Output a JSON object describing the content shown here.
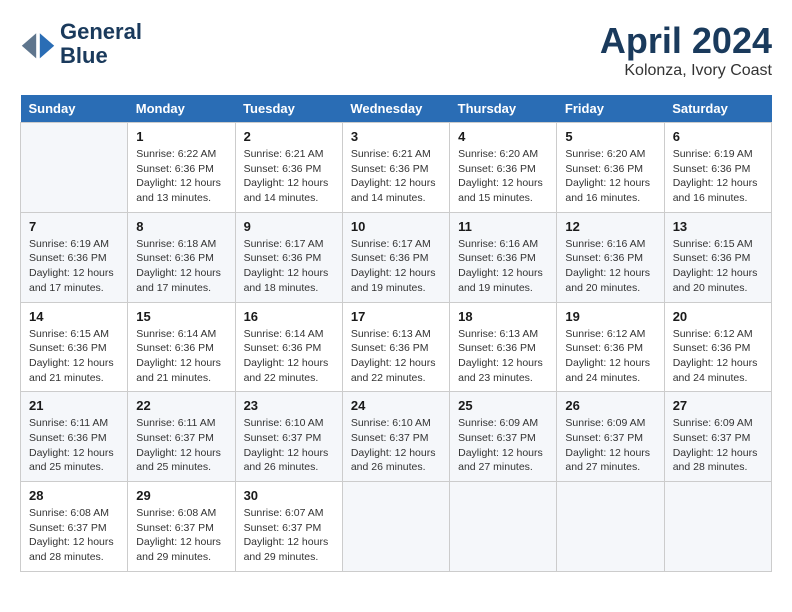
{
  "header": {
    "logo_line1": "General",
    "logo_line2": "Blue",
    "title": "April 2024",
    "subtitle": "Kolonza, Ivory Coast"
  },
  "calendar": {
    "days_of_week": [
      "Sunday",
      "Monday",
      "Tuesday",
      "Wednesday",
      "Thursday",
      "Friday",
      "Saturday"
    ],
    "weeks": [
      [
        {
          "day": "",
          "info": ""
        },
        {
          "day": "1",
          "info": "Sunrise: 6:22 AM\nSunset: 6:36 PM\nDaylight: 12 hours\nand 13 minutes."
        },
        {
          "day": "2",
          "info": "Sunrise: 6:21 AM\nSunset: 6:36 PM\nDaylight: 12 hours\nand 14 minutes."
        },
        {
          "day": "3",
          "info": "Sunrise: 6:21 AM\nSunset: 6:36 PM\nDaylight: 12 hours\nand 14 minutes."
        },
        {
          "day": "4",
          "info": "Sunrise: 6:20 AM\nSunset: 6:36 PM\nDaylight: 12 hours\nand 15 minutes."
        },
        {
          "day": "5",
          "info": "Sunrise: 6:20 AM\nSunset: 6:36 PM\nDaylight: 12 hours\nand 16 minutes."
        },
        {
          "day": "6",
          "info": "Sunrise: 6:19 AM\nSunset: 6:36 PM\nDaylight: 12 hours\nand 16 minutes."
        }
      ],
      [
        {
          "day": "7",
          "info": "Sunrise: 6:19 AM\nSunset: 6:36 PM\nDaylight: 12 hours\nand 17 minutes."
        },
        {
          "day": "8",
          "info": "Sunrise: 6:18 AM\nSunset: 6:36 PM\nDaylight: 12 hours\nand 17 minutes."
        },
        {
          "day": "9",
          "info": "Sunrise: 6:17 AM\nSunset: 6:36 PM\nDaylight: 12 hours\nand 18 minutes."
        },
        {
          "day": "10",
          "info": "Sunrise: 6:17 AM\nSunset: 6:36 PM\nDaylight: 12 hours\nand 19 minutes."
        },
        {
          "day": "11",
          "info": "Sunrise: 6:16 AM\nSunset: 6:36 PM\nDaylight: 12 hours\nand 19 minutes."
        },
        {
          "day": "12",
          "info": "Sunrise: 6:16 AM\nSunset: 6:36 PM\nDaylight: 12 hours\nand 20 minutes."
        },
        {
          "day": "13",
          "info": "Sunrise: 6:15 AM\nSunset: 6:36 PM\nDaylight: 12 hours\nand 20 minutes."
        }
      ],
      [
        {
          "day": "14",
          "info": "Sunrise: 6:15 AM\nSunset: 6:36 PM\nDaylight: 12 hours\nand 21 minutes."
        },
        {
          "day": "15",
          "info": "Sunrise: 6:14 AM\nSunset: 6:36 PM\nDaylight: 12 hours\nand 21 minutes."
        },
        {
          "day": "16",
          "info": "Sunrise: 6:14 AM\nSunset: 6:36 PM\nDaylight: 12 hours\nand 22 minutes."
        },
        {
          "day": "17",
          "info": "Sunrise: 6:13 AM\nSunset: 6:36 PM\nDaylight: 12 hours\nand 22 minutes."
        },
        {
          "day": "18",
          "info": "Sunrise: 6:13 AM\nSunset: 6:36 PM\nDaylight: 12 hours\nand 23 minutes."
        },
        {
          "day": "19",
          "info": "Sunrise: 6:12 AM\nSunset: 6:36 PM\nDaylight: 12 hours\nand 24 minutes."
        },
        {
          "day": "20",
          "info": "Sunrise: 6:12 AM\nSunset: 6:36 PM\nDaylight: 12 hours\nand 24 minutes."
        }
      ],
      [
        {
          "day": "21",
          "info": "Sunrise: 6:11 AM\nSunset: 6:36 PM\nDaylight: 12 hours\nand 25 minutes."
        },
        {
          "day": "22",
          "info": "Sunrise: 6:11 AM\nSunset: 6:37 PM\nDaylight: 12 hours\nand 25 minutes."
        },
        {
          "day": "23",
          "info": "Sunrise: 6:10 AM\nSunset: 6:37 PM\nDaylight: 12 hours\nand 26 minutes."
        },
        {
          "day": "24",
          "info": "Sunrise: 6:10 AM\nSunset: 6:37 PM\nDaylight: 12 hours\nand 26 minutes."
        },
        {
          "day": "25",
          "info": "Sunrise: 6:09 AM\nSunset: 6:37 PM\nDaylight: 12 hours\nand 27 minutes."
        },
        {
          "day": "26",
          "info": "Sunrise: 6:09 AM\nSunset: 6:37 PM\nDaylight: 12 hours\nand 27 minutes."
        },
        {
          "day": "27",
          "info": "Sunrise: 6:09 AM\nSunset: 6:37 PM\nDaylight: 12 hours\nand 28 minutes."
        }
      ],
      [
        {
          "day": "28",
          "info": "Sunrise: 6:08 AM\nSunset: 6:37 PM\nDaylight: 12 hours\nand 28 minutes."
        },
        {
          "day": "29",
          "info": "Sunrise: 6:08 AM\nSunset: 6:37 PM\nDaylight: 12 hours\nand 29 minutes."
        },
        {
          "day": "30",
          "info": "Sunrise: 6:07 AM\nSunset: 6:37 PM\nDaylight: 12 hours\nand 29 minutes."
        },
        {
          "day": "",
          "info": ""
        },
        {
          "day": "",
          "info": ""
        },
        {
          "day": "",
          "info": ""
        },
        {
          "day": "",
          "info": ""
        }
      ]
    ]
  }
}
